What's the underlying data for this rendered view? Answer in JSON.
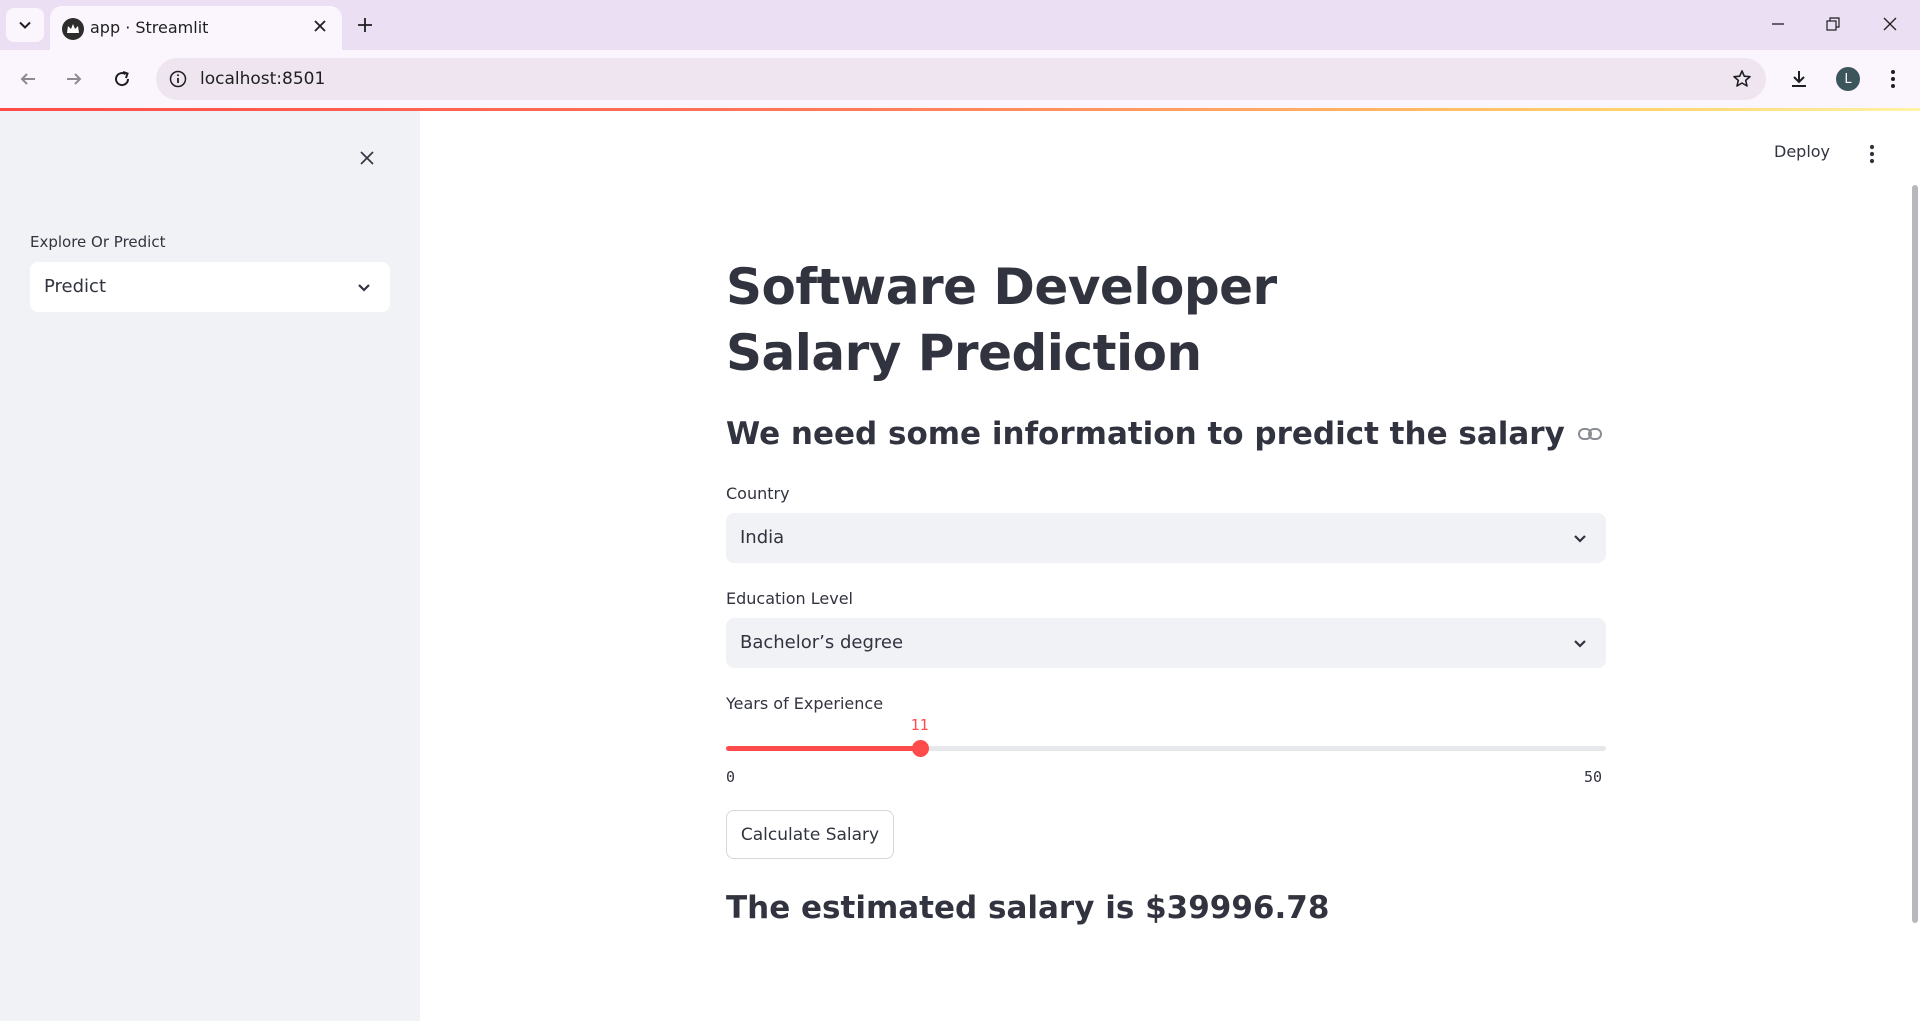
{
  "browser": {
    "tab_title": "app · Streamlit",
    "url": "localhost:8501",
    "profile_initial": "L"
  },
  "sidebar": {
    "select_label": "Explore Or Predict",
    "select_value": "Predict"
  },
  "header": {
    "deploy_label": "Deploy"
  },
  "main": {
    "title": "Software Developer Salary Prediction",
    "subheader": "We need some information to predict the salary",
    "country": {
      "label": "Country",
      "value": "India"
    },
    "education": {
      "label": "Education Level",
      "value": "Bachelor’s degree"
    },
    "experience": {
      "label": "Years of Experience",
      "value": 11,
      "min": 0,
      "max": 50
    },
    "button_label": "Calculate Salary",
    "result": "The estimated salary is $39996.78"
  },
  "colors": {
    "accent": "#ff4b4b",
    "text": "#31333f",
    "sidebar_bg": "#f0f2f6",
    "chrome_bg": "#ebdff4"
  },
  "icons": [
    "tab-search-icon",
    "streamlit-favicon-icon",
    "close-icon",
    "plus-icon",
    "minimize-icon",
    "restore-icon",
    "back-arrow-icon",
    "forward-arrow-icon",
    "reload-icon",
    "info-icon",
    "star-icon",
    "download-icon",
    "kebab-menu-icon",
    "chevron-down-icon",
    "link-icon"
  ]
}
